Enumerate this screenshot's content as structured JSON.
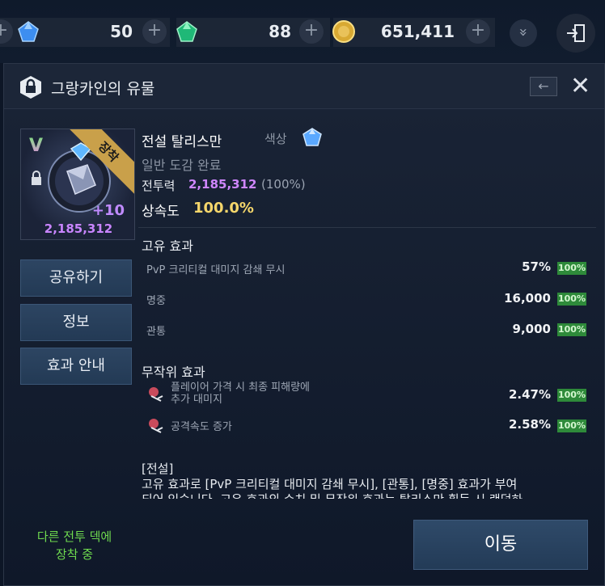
{
  "topbar": {
    "currencies": [
      {
        "icon": "blue-gem-icon",
        "value": "50",
        "color": "#4aa7ff"
      },
      {
        "icon": "green-gem-icon",
        "value": "88",
        "color": "#2fd18a"
      },
      {
        "icon": "gold-coin-icon",
        "value": "651,411",
        "color": "#e3b93d"
      }
    ],
    "plus": "+",
    "chevron": "»",
    "exit_icon": "exit-door-icon"
  },
  "panel": {
    "title": "그랑카인의 유물",
    "back_arrow": "←",
    "close": "✕"
  },
  "item": {
    "grade_mark": "V",
    "equip_tag": "장착",
    "enhance": "+10",
    "card_power": "2,185,312",
    "name": "전설 탈리스만",
    "color_label": "색상",
    "collection": "일반 도감 완료",
    "power_label": "전투력",
    "power_value": "2,185,312",
    "power_pct": "(100%)",
    "inherit_label": "상속도",
    "inherit_value": "100.0%"
  },
  "buttons": {
    "share": "공유하기",
    "info": "정보",
    "effect_guide": "효과 안내",
    "move": "이동"
  },
  "unique_effects": {
    "title": "고유 효과",
    "rows": [
      {
        "label": "PvP 크리티컬 대미지 감쇄 무시",
        "value": "57%",
        "badge": "100%"
      },
      {
        "label": "명중",
        "value": "16,000",
        "badge": "100%"
      },
      {
        "label": "관통",
        "value": "9,000",
        "badge": "100%"
      }
    ]
  },
  "random_effects": {
    "title": "무작위 효과",
    "rows": [
      {
        "label_line1": "플레이어 가격 시 최종 피해량에",
        "label_line2": "추가 대미지",
        "value": "2.47%",
        "badge": "100%"
      },
      {
        "label_line1": "공격속도 증가",
        "label_line2": "",
        "value": "2.58%",
        "badge": "100%"
      }
    ]
  },
  "description": {
    "tag": "[전설]",
    "line1": "고유 효과로 [PvP 크리티컬 대미지 감쇄 무시], [관통], [명중] 효과가 부여",
    "line2": "되어 있습니다. 고유 효과의 수치 및 무작위 효과는 탈리스만 획득 시 랜덤하"
  },
  "deck_note": {
    "line1": "다른 전투 덱에",
    "line2": "장착 중"
  }
}
